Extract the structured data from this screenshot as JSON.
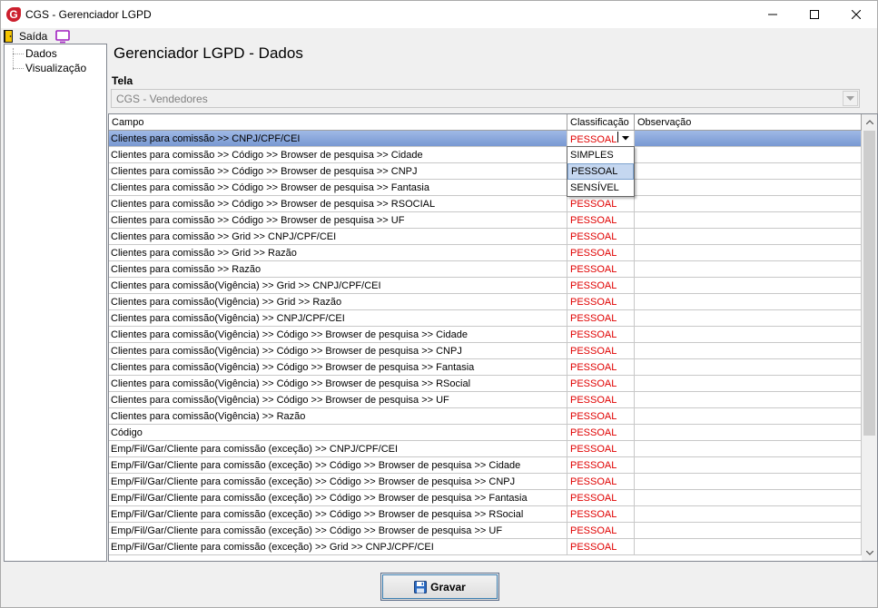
{
  "window": {
    "title": "CGS - Gerenciador LGPD",
    "logo_letter": "G"
  },
  "menu": {
    "exit_label": "Saída"
  },
  "tree": {
    "items": [
      "Dados",
      "Visualização"
    ]
  },
  "main": {
    "title": "Gerenciador LGPD - Dados",
    "tela_label": "Tela",
    "tela_value": "CGS - Vendedores"
  },
  "grid": {
    "headers": {
      "campo": "Campo",
      "classificacao": "Classificação",
      "observacao": "Observação"
    },
    "editing_value": "PESSOAL",
    "rows": [
      {
        "campo": "Clientes para comissão >> CNPJ/CPF/CEI",
        "classificacao": "PESSOAL",
        "observacao": ""
      },
      {
        "campo": "Clientes para comissão >> Código >> Browser de pesquisa >> Cidade",
        "classificacao": "",
        "observacao": ""
      },
      {
        "campo": "Clientes para comissão >> Código >> Browser de pesquisa >> CNPJ",
        "classificacao": "",
        "observacao": ""
      },
      {
        "campo": "Clientes para comissão >> Código >> Browser de pesquisa >> Fantasia",
        "classificacao": "",
        "observacao": ""
      },
      {
        "campo": "Clientes para comissão >> Código >> Browser de pesquisa >> RSOCIAL",
        "classificacao": "PESSOAL",
        "observacao": ""
      },
      {
        "campo": "Clientes para comissão >> Código >> Browser de pesquisa >> UF",
        "classificacao": "PESSOAL",
        "observacao": ""
      },
      {
        "campo": "Clientes para comissão >> Grid >> CNPJ/CPF/CEI",
        "classificacao": "PESSOAL",
        "observacao": ""
      },
      {
        "campo": "Clientes para comissão >> Grid >> Razão",
        "classificacao": "PESSOAL",
        "observacao": ""
      },
      {
        "campo": "Clientes para comissão >> Razão",
        "classificacao": "PESSOAL",
        "observacao": ""
      },
      {
        "campo": "Clientes para comissão(Vigência) >> Grid >> CNPJ/CPF/CEI",
        "classificacao": "PESSOAL",
        "observacao": ""
      },
      {
        "campo": "Clientes para comissão(Vigência) >> Grid >> Razão",
        "classificacao": "PESSOAL",
        "observacao": ""
      },
      {
        "campo": "Clientes para comissão(Vigência) >> CNPJ/CPF/CEI",
        "classificacao": "PESSOAL",
        "observacao": ""
      },
      {
        "campo": "Clientes para comissão(Vigência) >> Código >> Browser de pesquisa >> Cidade",
        "classificacao": "PESSOAL",
        "observacao": ""
      },
      {
        "campo": "Clientes para comissão(Vigência) >> Código >> Browser de pesquisa >> CNPJ",
        "classificacao": "PESSOAL",
        "observacao": ""
      },
      {
        "campo": "Clientes para comissão(Vigência) >> Código >> Browser de pesquisa >> Fantasia",
        "classificacao": "PESSOAL",
        "observacao": ""
      },
      {
        "campo": "Clientes para comissão(Vigência) >> Código >> Browser de pesquisa >> RSocial",
        "classificacao": "PESSOAL",
        "observacao": ""
      },
      {
        "campo": "Clientes para comissão(Vigência) >> Código >> Browser de pesquisa >> UF",
        "classificacao": "PESSOAL",
        "observacao": ""
      },
      {
        "campo": "Clientes para comissão(Vigência) >> Razão",
        "classificacao": "PESSOAL",
        "observacao": ""
      },
      {
        "campo": "Código",
        "classificacao": "PESSOAL",
        "observacao": ""
      },
      {
        "campo": "Emp/Fil/Gar/Cliente para comissão (exceção) >> CNPJ/CPF/CEI",
        "classificacao": "PESSOAL",
        "observacao": ""
      },
      {
        "campo": "Emp/Fil/Gar/Cliente para comissão (exceção) >> Código >> Browser de pesquisa >> Cidade",
        "classificacao": "PESSOAL",
        "observacao": ""
      },
      {
        "campo": "Emp/Fil/Gar/Cliente para comissão (exceção) >> Código >> Browser de pesquisa >> CNPJ",
        "classificacao": "PESSOAL",
        "observacao": ""
      },
      {
        "campo": "Emp/Fil/Gar/Cliente para comissão (exceção) >> Código >> Browser de pesquisa >> Fantasia",
        "classificacao": "PESSOAL",
        "observacao": ""
      },
      {
        "campo": "Emp/Fil/Gar/Cliente para comissão (exceção) >> Código >> Browser de pesquisa >> RSocial",
        "classificacao": "PESSOAL",
        "observacao": ""
      },
      {
        "campo": "Emp/Fil/Gar/Cliente para comissão (exceção) >> Código >> Browser de pesquisa >> UF",
        "classificacao": "PESSOAL",
        "observacao": ""
      },
      {
        "campo": "Emp/Fil/Gar/Cliente para comissão (exceção) >> Grid >> CNPJ/CPF/CEI",
        "classificacao": "PESSOAL",
        "observacao": ""
      }
    ],
    "dropdown_options": [
      "SIMPLES",
      "PESSOAL",
      "SENSÍVEL"
    ],
    "dropdown_selected": "PESSOAL"
  },
  "footer": {
    "save_label": "Gravar"
  },
  "colors": {
    "accent": "#e00000",
    "selection": "#9fb9e6",
    "dropdown_highlight": "#c5d7f0"
  }
}
